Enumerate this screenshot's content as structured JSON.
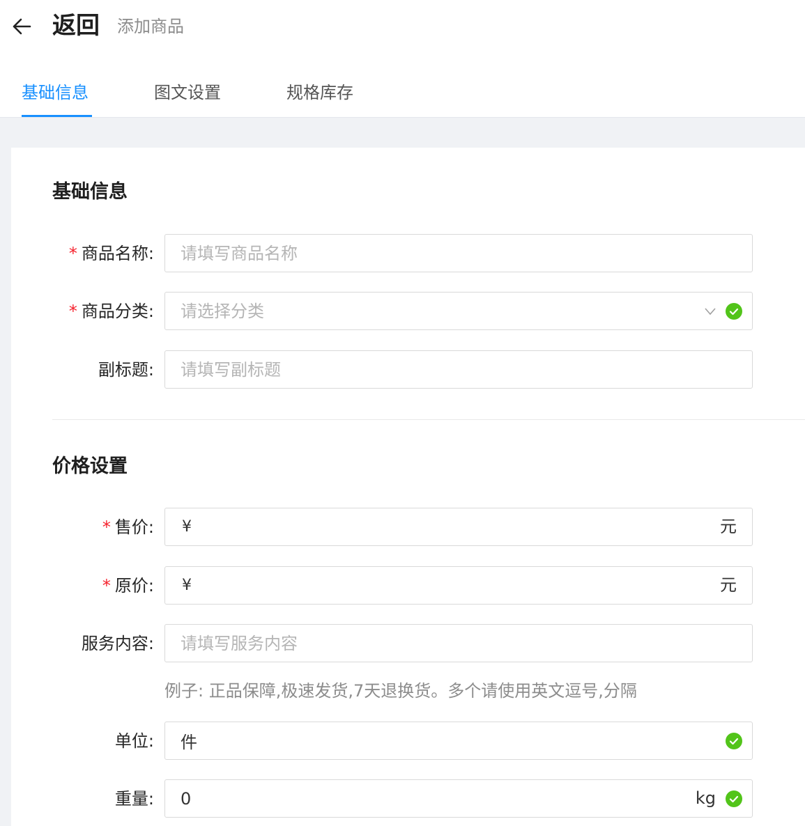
{
  "header": {
    "back_label": "返回",
    "subtitle": "添加商品",
    "tabs": [
      {
        "label": "基础信息",
        "active": true
      },
      {
        "label": "图文设置",
        "active": false
      },
      {
        "label": "规格库存",
        "active": false
      }
    ]
  },
  "basic_section": {
    "title": "基础信息",
    "name": {
      "label": "商品名称:",
      "required": true,
      "placeholder": "请填写商品名称",
      "value": ""
    },
    "category": {
      "label": "商品分类:",
      "required": true,
      "placeholder": "请选择分类",
      "value": ""
    },
    "subtitle": {
      "label": "副标题:",
      "required": false,
      "placeholder": "请填写副标题",
      "value": ""
    }
  },
  "price_section": {
    "title": "价格设置",
    "sale_price": {
      "label": "售价:",
      "required": true,
      "prefix": "¥",
      "suffix": "元",
      "value": ""
    },
    "original_price": {
      "label": "原价:",
      "required": true,
      "prefix": "¥",
      "suffix": "元",
      "value": ""
    },
    "service": {
      "label": "服务内容:",
      "required": false,
      "placeholder": "请填写服务内容",
      "value": "",
      "hint": "例子: 正品保障,极速发货,7天退换货。多个请使用英文逗号,分隔"
    },
    "unit": {
      "label": "单位:",
      "required": false,
      "value": "件"
    },
    "weight": {
      "label": "重量:",
      "required": false,
      "value": "0",
      "suffix": "kg"
    }
  },
  "required_mark": "*",
  "colors": {
    "accent": "#1890ff",
    "required": "#f5222d",
    "valid": "#52c41a",
    "page_bg": "#f0f2f5"
  },
  "icons": {
    "back": "arrow-left-icon",
    "select": "chevron-down-icon",
    "valid": "check-circle-icon"
  }
}
